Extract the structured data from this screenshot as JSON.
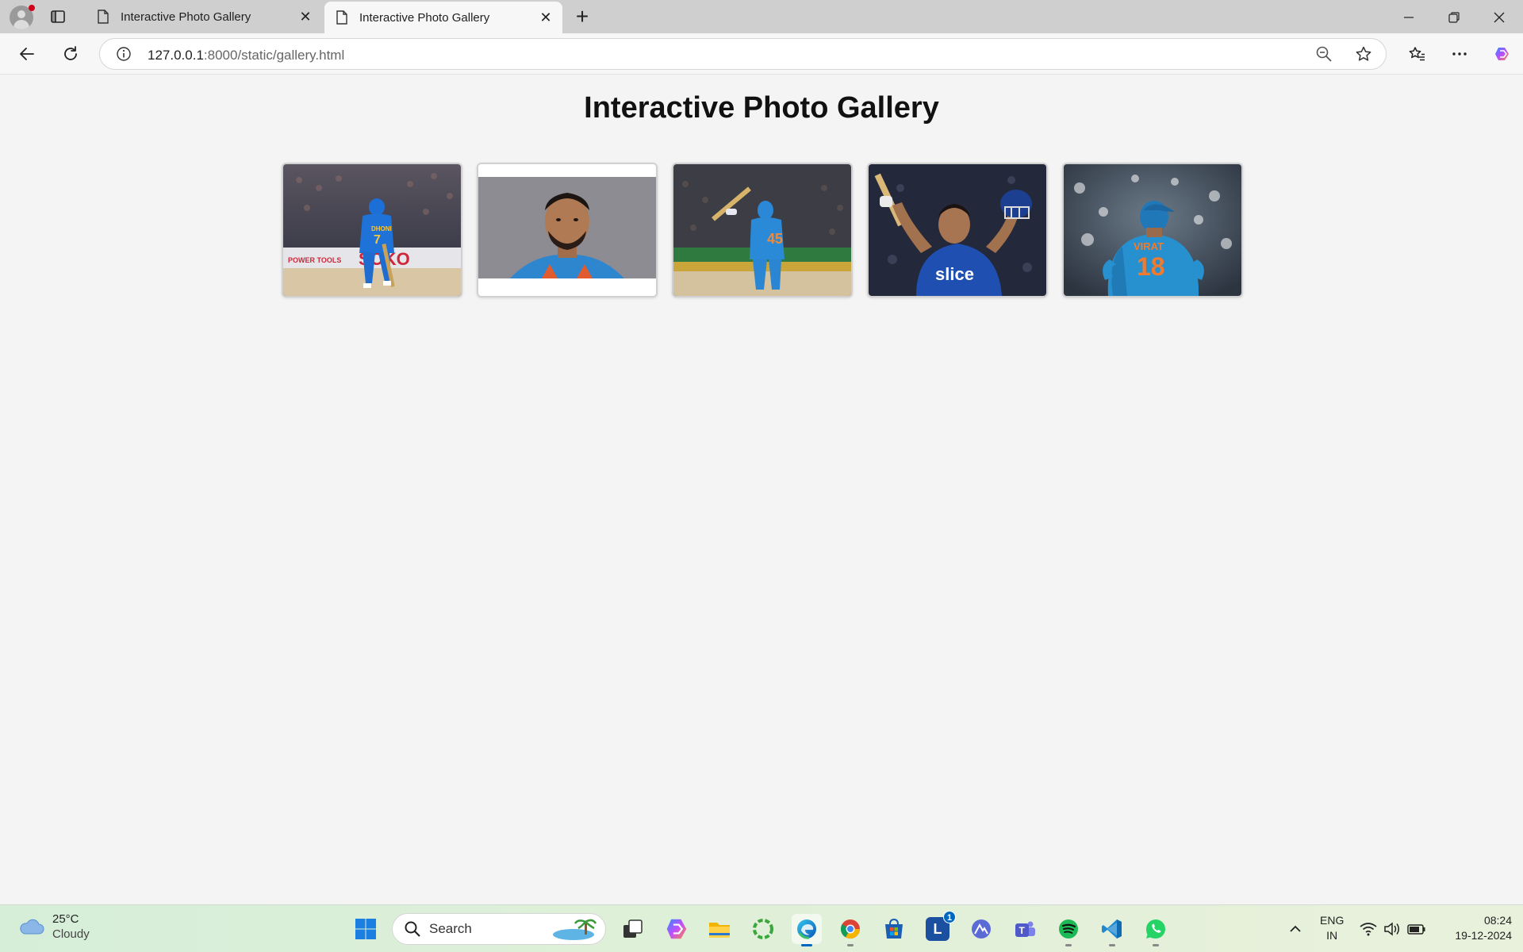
{
  "browser": {
    "tabs": [
      {
        "title": "Interactive Photo Gallery",
        "active": false
      },
      {
        "title": "Interactive Photo Gallery",
        "active": true
      }
    ],
    "url_host": "127.0.0.1",
    "url_rest": ":8000/static/gallery.html",
    "icons": {
      "back": "back-arrow-icon",
      "reload": "reload-icon",
      "info": "info-icon",
      "zoom": "zoom-out-icon",
      "favorite": "star-icon",
      "favorites": "favorites-icon",
      "menu": "more-icon",
      "copilot": "copilot-icon"
    }
  },
  "page": {
    "title": "Interactive Photo Gallery",
    "photos": [
      {
        "name": "photo-cricketer-dhoni",
        "jersey_text": "DHONI 7",
        "board_text": "SOKO"
      },
      {
        "name": "photo-cricketer-portrait",
        "jersey_text": ""
      },
      {
        "name": "photo-cricketer-batting",
        "jersey_text": "45"
      },
      {
        "name": "photo-cricketer-celebrating",
        "jersey_text": "slice"
      },
      {
        "name": "photo-cricketer-virat",
        "jersey_text": "VIRAT 18"
      }
    ]
  },
  "taskbar": {
    "weather_temp": "25°C",
    "weather_cond": "Cloudy",
    "search_placeholder": "Search",
    "apps": [
      "start",
      "task-view",
      "copilot",
      "file-explorer",
      "app-green-ring",
      "edge",
      "chrome",
      "store",
      "l-app",
      "app-mountain",
      "teams",
      "spotify",
      "vscode",
      "whatsapp"
    ],
    "l_app_badge": "1",
    "lang_top": "ENG",
    "lang_bottom": "IN",
    "time": "08:24",
    "date": "19-12-2024"
  },
  "colors": {
    "accent": "#0067c0",
    "page_bg": "#f4f4f4",
    "tabstrip_bg": "#cfcfcf",
    "jersey_blue": "#1e7fd0"
  }
}
